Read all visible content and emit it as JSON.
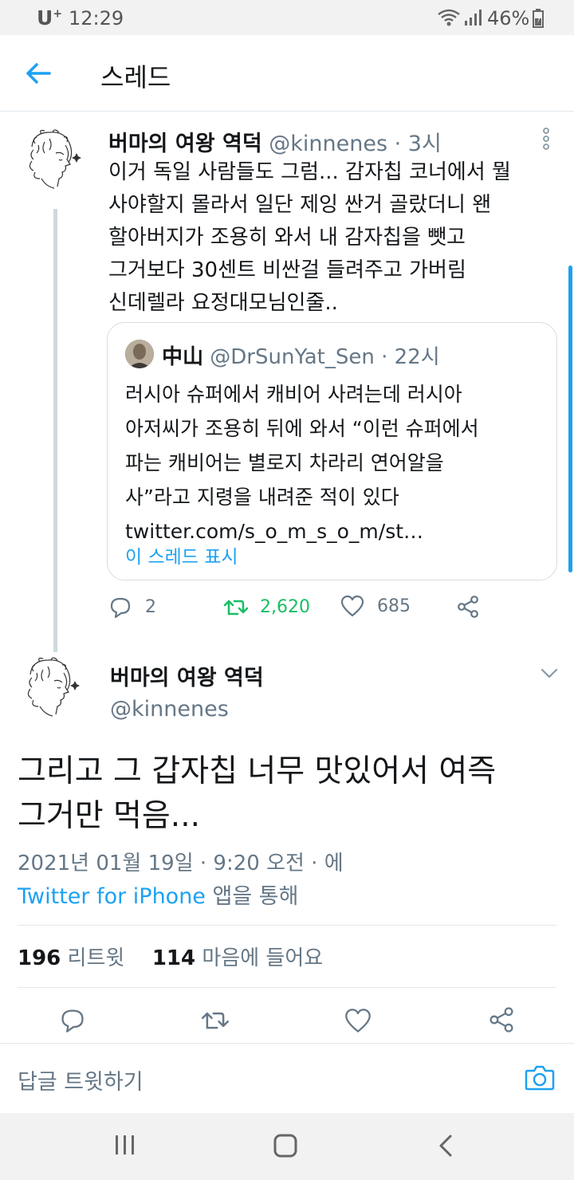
{
  "status_bar": {
    "carrier": "U",
    "carrier_sup": "+",
    "time": "12:29",
    "battery": "46%"
  },
  "app_bar": {
    "title": "스레드"
  },
  "tweet1": {
    "name": "버마의 여왕 역덕",
    "handle": "@kinnenes",
    "time": " · 3시",
    "lines": [
      "이거 독일 사람들도 그럼... 감자칩 코너에서 뭘",
      "사야할지 몰라서 일단 제잉 싼거 골랐더니 왠",
      "할아버지가 조용히 와서 내 감자칩을 뺏고",
      "그거보다 30센트 비싼걸 들려주고 가버림",
      "신데렐라 요정대모님인줄.."
    ],
    "quote": {
      "name": "中山",
      "handle": "@DrSunYat_Sen",
      "time": " · 22시",
      "lines": [
        "러시아 슈퍼에서 캐비어 사려는데 러시아",
        "아저씨가 조용히 뒤에 와서 “이런 슈퍼에서",
        "파는 캐비어는 별로지 차라리 연어알을",
        "사”라고 지령을 내려준 적이 있다",
        "twitter.com/s_o_m_s_o_m/st…"
      ],
      "show_thread": "이 스레드 표시"
    },
    "actions": {
      "replies": "2",
      "retweets": "2,620",
      "likes": "685"
    }
  },
  "tweet2": {
    "name": "버마의 여왕 역덕",
    "handle": "@kinnenes",
    "lines": [
      "그리고 그 갑자칩 너무 맛있어서 여즉",
      "그거만 먹음..."
    ],
    "timestamp": "2021년 01월 19일 · 9:20 오전 · 에",
    "source_link": "Twitter for iPhone",
    "source_suffix": " 앱을 통해",
    "retweet_count": "196",
    "retweet_label": " 리트윗",
    "like_count": "114",
    "like_label": " 마음에 들어요"
  },
  "reply_bar": {
    "placeholder": "답글 트윗하기"
  },
  "colors": {
    "accent": "#1da1f2",
    "retweet": "#17bf63",
    "secondary": "#657786"
  },
  "icons": [
    "back-arrow-icon",
    "more-vertical-icon",
    "reply-icon",
    "retweet-icon",
    "heart-icon",
    "share-icon",
    "chevron-down-icon",
    "camera-icon",
    "recents-icon",
    "home-icon",
    "back-icon"
  ]
}
